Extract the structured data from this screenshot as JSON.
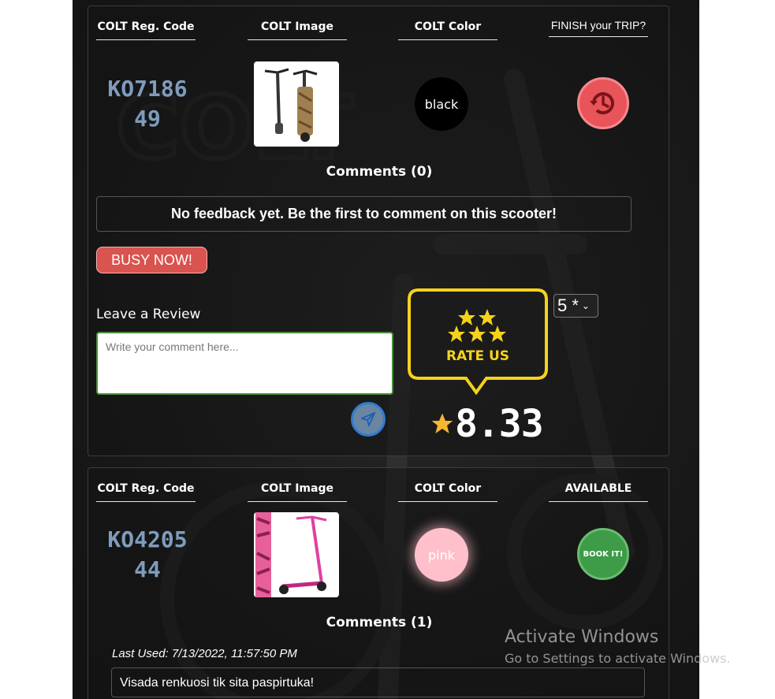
{
  "scooters": [
    {
      "headers": {
        "reg": "COLT Reg. Code",
        "image": "COLT Image",
        "color": "COLT Color",
        "action": "FINISH your TRIP?"
      },
      "reg_code_line1": "KO7186",
      "reg_code_line2": "49",
      "color_value": "black",
      "action_icon": "history-icon",
      "comments_title": "Comments (0)",
      "feedback_text": "No feedback yet. Be the first to comment on this scooter!",
      "status_button": "BUSY NOW!",
      "review": {
        "label": "Leave a Review",
        "placeholder": "Write your comment here...",
        "rating_select_value": "5 *",
        "badge_text": "RATE US",
        "average_score": "8.33"
      }
    },
    {
      "headers": {
        "reg": "COLT Reg. Code",
        "image": "COLT Image",
        "color": "COLT Color",
        "action": "AVAILABLE"
      },
      "reg_code_line1": "KO4205",
      "reg_code_line2": "44",
      "color_value": "pink",
      "action_button": "BOOK IT!",
      "comments_title": "Comments (1)",
      "comments": [
        {
          "last_used": "Last Used: 7/13/2022, 11:57:50 PM",
          "text": "Visada renkuosi tik sita paspirtuka!"
        }
      ]
    }
  ],
  "watermark": {
    "title": "Activate Windows",
    "subtitle": "Go to Settings to activate Windows."
  },
  "colors": {
    "busy": "#d9534f",
    "book": "#3e9b48",
    "finish": "#e8545a",
    "badge": "#f5d21c",
    "reg_code": "#7f9cbd"
  }
}
